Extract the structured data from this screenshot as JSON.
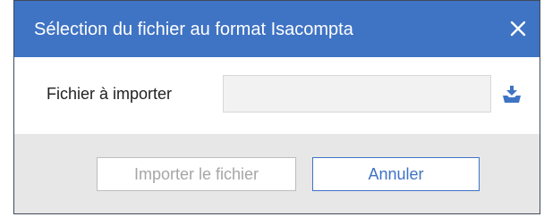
{
  "dialog": {
    "title": "Sélection du fichier au format Isacompta",
    "close_icon": "close-icon"
  },
  "form": {
    "file_label": "Fichier à importer",
    "file_value": "",
    "file_placeholder": "",
    "import_icon": "file-import-icon"
  },
  "footer": {
    "import_label": "Importer le fichier",
    "import_disabled": true,
    "cancel_label": "Annuler"
  },
  "colors": {
    "titlebar": "#3f73c4",
    "accent": "#3f73c4",
    "footer_bg": "#e7e7e7",
    "disabled_text": "#a6a6a6"
  }
}
